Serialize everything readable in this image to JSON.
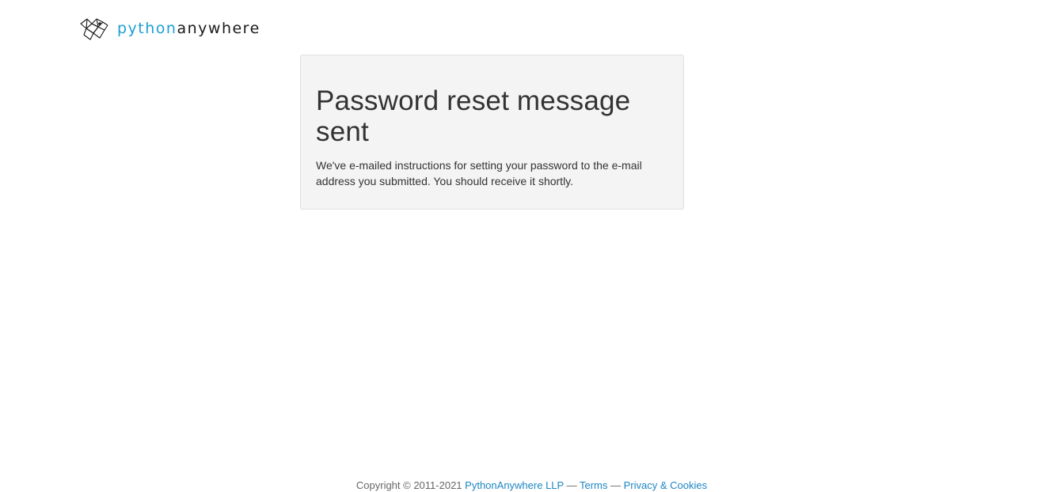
{
  "header": {
    "logo_icon": "pythonanywhere-snake-logo-icon",
    "logo_text_part1": "python",
    "logo_text_part2": "anywhere",
    "brand_color": "#1d9fd2"
  },
  "main": {
    "title": "Password reset message sent",
    "message": "We've e-mailed instructions for setting your password to the e-mail address you submitted. You should receive it shortly."
  },
  "footer": {
    "copyright": "Copyright © 2011-2021",
    "company_link": "PythonAnywhere LLP",
    "separator1": "—",
    "terms_link": "Terms",
    "separator2": "—",
    "privacy_link": "Privacy & Cookies",
    "link_color": "#1d86c4"
  }
}
